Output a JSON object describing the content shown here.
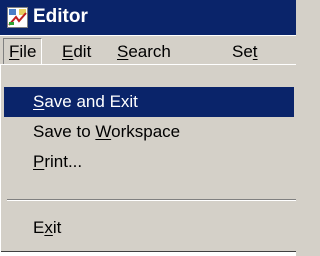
{
  "window": {
    "title": "Editor"
  },
  "menubar": {
    "items": [
      {
        "pre": "",
        "key": "F",
        "post": "ile"
      },
      {
        "pre": "",
        "key": "E",
        "post": "dit"
      },
      {
        "pre": "",
        "key": "S",
        "post": "earch"
      },
      {
        "pre": "Se",
        "key": "t",
        "post": ""
      }
    ]
  },
  "file_menu": {
    "items": [
      {
        "pre": "",
        "key": "S",
        "post": "ave and Exit"
      },
      {
        "pre": "Save to ",
        "key": "W",
        "post": "orkspace"
      },
      {
        "pre": "",
        "key": "P",
        "post": "rint..."
      },
      {
        "pre": "E",
        "key": "x",
        "post": "it"
      }
    ]
  },
  "colors": {
    "titlebar": "#0a246a",
    "selection": "#0a246a",
    "face": "#d4d0c8"
  },
  "icons": {
    "app": "editor-app-icon"
  }
}
